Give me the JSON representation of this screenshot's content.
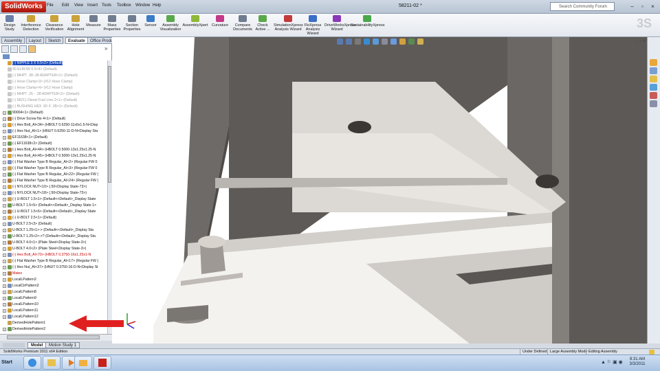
{
  "app": {
    "logo": "SolidWorks",
    "doc_title": "58211-02 *"
  },
  "menu": [
    "File",
    "Edit",
    "View",
    "Insert",
    "Tools",
    "Toolbox",
    "Window",
    "Help"
  ],
  "search": {
    "placeholder": "Search Community Forum"
  },
  "commands": [
    {
      "label": "Design Study",
      "icon": "design-study-icon",
      "color": "#6a7fa8"
    },
    {
      "label": "Interference Detection",
      "icon": "interference-icon",
      "color": "#c9a23a"
    },
    {
      "label": "Clearance Verification",
      "icon": "clearance-icon",
      "color": "#c9a23a"
    },
    {
      "label": "Hole Alignment",
      "icon": "hole-alignment-icon",
      "color": "#c9a23a"
    },
    {
      "label": "Measure",
      "icon": "measure-icon",
      "color": "#6f7c8f"
    },
    {
      "label": "Mass Properties",
      "icon": "mass-properties-icon",
      "color": "#6f7c8f"
    },
    {
      "label": "Section Properties",
      "icon": "section-properties-icon",
      "color": "#6f7c8f"
    },
    {
      "label": "Sensor",
      "icon": "sensor-icon",
      "color": "#3a7bc8"
    },
    {
      "label": "Assembly Visualization",
      "icon": "assembly-visualization-icon",
      "color": "#59a84a"
    },
    {
      "label": "AssemblyXpert",
      "icon": "assemblyxpert-icon",
      "color": "#8fb83a"
    },
    {
      "label": "Curvature",
      "icon": "curvature-icon",
      "color": "#c33a8a"
    },
    {
      "label": "Compare Documents",
      "icon": "compare-documents-icon",
      "color": "#6f7c8f"
    },
    {
      "label": "Check Active ...",
      "icon": "check-active-icon",
      "color": "#59a84a"
    },
    {
      "label": "SimulationXpress Analysis Wizard",
      "icon": "simulationxpress-icon",
      "color": "#c23a3a"
    },
    {
      "label": "FloXpress Analysis Wizard",
      "icon": "floxpress-icon",
      "color": "#3a6ec8"
    },
    {
      "label": "DriveWorksXpress Wizard",
      "icon": "driveworksxpress-icon",
      "color": "#8a3ab8"
    },
    {
      "label": "SustainabilityXpress",
      "icon": "sustainabilityxpress-icon",
      "color": "#4aa84a"
    }
  ],
  "tabs": [
    "Assembly",
    "Layout",
    "Sketch",
    "Evaluate",
    "Office Products"
  ],
  "active_tab": "Evaluate",
  "tree": [
    {
      "text": "(-) NIPPLE 3 X 0.5<2> (Default)",
      "state": "sel",
      "expander": ""
    },
    {
      "text": "90 ELBOW 0.5<4> (Default)",
      "state": "dim",
      "expander": ""
    },
    {
      "text": "(-) MHPT .38-.38 ADAPTER<1> (Default)",
      "state": "dim",
      "expander": ""
    },
    {
      "text": "(-) Hose Clamp<3> (#12 Hose Clamp)",
      "state": "dim",
      "expander": ""
    },
    {
      "text": "(-) Hose Clamp<4> (#12 Hose Clamp)",
      "state": "dim",
      "expander": ""
    },
    {
      "text": "(-) MHPT .25 - .38 ADAPTER<2> (Default)",
      "state": "dim",
      "expander": ""
    },
    {
      "text": "(-) 58211 Diesel Fuel Line-2<1> (Default)",
      "state": "dim",
      "expander": ""
    },
    {
      "text": "(-) BUSHING HEX .50 X .38<1> (Default)",
      "state": "dim",
      "expander": ""
    },
    {
      "text": "90004<1> (Default)",
      "state": "",
      "expander": "+"
    },
    {
      "text": "(-) Drive Screw No 4<1> (Default)",
      "state": "",
      "expander": "+"
    },
    {
      "text": "(-) Hex Bolt_AI<34> (HBOLT 0.6250-11x6x1.5-N<Disp",
      "state": "",
      "expander": "+"
    },
    {
      "text": "(-) Hex Nut_AI<1> (HNUT 0.6250-11-D-N<Display Sta",
      "state": "",
      "expander": "+"
    },
    {
      "text": "EF11638<1> (Default)",
      "state": "",
      "expander": "+"
    },
    {
      "text": "(-) EF11638<2> (Default)",
      "state": "",
      "expander": "+"
    },
    {
      "text": "(-) Hex Bolt_AI<44> (HBOLT 0.5000-13x1.25x1.25-N",
      "state": "",
      "expander": "+"
    },
    {
      "text": "(-) Hex Bolt_AI<45> (HBOLT 0.5000-13x1.25x1.25-N",
      "state": "",
      "expander": "+"
    },
    {
      "text": "(-) Flat Washer Type B Regular_AI<2> (Regular FW 0",
      "state": "",
      "expander": "+"
    },
    {
      "text": "(-) Flat Washer Type B Regular_AI<3> (Regular FW 0",
      "state": "",
      "expander": "+"
    },
    {
      "text": "(-) Flat Washer Type B Regular_AI<22> (Regular FW (",
      "state": "",
      "expander": "+"
    },
    {
      "text": "(-) Flat Washer Type B Regular_AI<24> (Regular FW (",
      "state": "",
      "expander": "+"
    },
    {
      "text": "(-) NYLOCK NUT<10> (.50<Display State-73>)",
      "state": "",
      "expander": "+"
    },
    {
      "text": "(-) NYLOCK NUT<18> (.50<Display State-73>)",
      "state": "",
      "expander": "+"
    },
    {
      "text": "(-) U-BOLT 1.5<1> (Default<<Default>_Display State",
      "state": "",
      "expander": "+"
    },
    {
      "text": "U-BOLT 1.5<5> (Default<<Default>_Display State 1>",
      "state": "",
      "expander": "+"
    },
    {
      "text": "(-) U-BOLT 1.5<6> (Default<<Default>_Display State",
      "state": "",
      "expander": "+"
    },
    {
      "text": "(-) U-BOLT 2.5<1> (Default)",
      "state": "",
      "expander": "+"
    },
    {
      "text": "U-BOLT 2.5<3> (Default)",
      "state": "",
      "expander": "+"
    },
    {
      "text": "U-BOLT 1.25<1>-> (Default<<Default>_Display Sta",
      "state": "",
      "expander": "+"
    },
    {
      "text": "U-BOLT 1.25<2>->? (Default<<Default>_Display Sta",
      "state": "",
      "expander": "+"
    },
    {
      "text": "U-BOLT 4.0<1> (Plate Steel<Display State-3>)",
      "state": "",
      "expander": "+"
    },
    {
      "text": "U-BOLT 4.0<2> (Plate Steel<Display State-3>)",
      "state": "",
      "expander": "+"
    },
    {
      "text": "(-) Hex Bolt_AI<70> (HBOLT 0.3750-16x1.25x1-N",
      "state": "red",
      "expander": "+"
    },
    {
      "text": "(-) Flat Washer Type B Regular_AI<17> (Regular FW (",
      "state": "",
      "expander": "+"
    },
    {
      "text": "(-) Hex Nut_AI<37> (HNUT 0.3750-16-D-N<Display St",
      "state": "",
      "expander": "+"
    },
    {
      "text": "Mates",
      "state": "red",
      "expander": "+"
    },
    {
      "text": "LocalLPattern2",
      "state": "",
      "expander": "+"
    },
    {
      "text": "LocalCirPattern2",
      "state": "",
      "expander": "+"
    },
    {
      "text": "LocalLPattern8",
      "state": "",
      "expander": "+"
    },
    {
      "text": "LocalLPattern9",
      "state": "",
      "expander": "+"
    },
    {
      "text": "LocalLPattern10",
      "state": "",
      "expander": "+"
    },
    {
      "text": "LocalLPattern11",
      "state": "",
      "expander": "+"
    },
    {
      "text": "LocalLPattern12",
      "state": "",
      "expander": "+"
    },
    {
      "text": "DerivedHolePattern1",
      "state": "",
      "expander": ""
    },
    {
      "text": "DerivedHolePattern2",
      "state": "",
      "expander": "+"
    }
  ],
  "bottom_tabs": [
    "Model",
    "Motion Study 1"
  ],
  "status": {
    "edition": "SolidWorks Premium 2011 x64 Edition",
    "defined": "Under Defined",
    "mode": "Large Assembly Mode",
    "editing": "Editing Assembly"
  },
  "taskbar": {
    "start": "Start",
    "time": "8:31 AM",
    "date": "3/3/2011"
  },
  "colors": {
    "accent": "#1b4bb8",
    "arrow": "#e02020",
    "error": "#cc0000"
  }
}
